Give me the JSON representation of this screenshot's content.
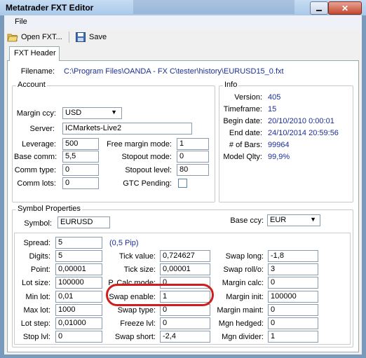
{
  "window": {
    "title": "Metatrader FXT Editor"
  },
  "menu": {
    "file": "File"
  },
  "toolbar": {
    "open": "Open FXT...",
    "save": "Save"
  },
  "tabs": {
    "fxt_header": "FXT Header"
  },
  "filename": {
    "label": "Filename:",
    "value": "C:\\Program Files\\OANDA - FX C\\tester\\history\\EURUSD15_0.fxt"
  },
  "account": {
    "title": "Account",
    "margin_ccy": {
      "label": "Margin ccy:",
      "value": "USD"
    },
    "server": {
      "label": "Server:",
      "value": "ICMarkets-Live2"
    },
    "leverage": {
      "label": "Leverage:",
      "value": "500"
    },
    "base_comm": {
      "label": "Base comm:",
      "value": "5,5"
    },
    "comm_type": {
      "label": "Comm type:",
      "value": "0"
    },
    "comm_lots": {
      "label": "Comm lots:",
      "value": "0"
    },
    "free_margin_mode": {
      "label": "Free margin mode:",
      "value": "1"
    },
    "stopout_mode": {
      "label": "Stopout mode:",
      "value": "0"
    },
    "stopout_level": {
      "label": "Stopout level:",
      "value": "80"
    },
    "gtc_pending": {
      "label": "GTC Pending:",
      "checked": false
    }
  },
  "info": {
    "title": "Info",
    "version": {
      "label": "Version:",
      "value": "405"
    },
    "timeframe": {
      "label": "Timeframe:",
      "value": "15"
    },
    "begin_date": {
      "label": "Begin date:",
      "value": "20/10/2010 0:00:01"
    },
    "end_date": {
      "label": "End date:",
      "value": "24/10/2014 20:59:56"
    },
    "bars": {
      "label": "# of Bars:",
      "value": "99964"
    },
    "model_qlty": {
      "label": "Model Qlty:",
      "value": "99,9%"
    }
  },
  "symbol": {
    "title": "Symbol Properties",
    "symbol": {
      "label": "Symbol:",
      "value": "EURUSD"
    },
    "base_ccy": {
      "label": "Base ccy:",
      "value": "EUR"
    },
    "spread": {
      "label": "Spread:",
      "value": "5",
      "note": "(0,5 Pip)"
    },
    "digits": {
      "label": "Digits:",
      "value": "5"
    },
    "point": {
      "label": "Point:",
      "value": "0,00001"
    },
    "lot_size": {
      "label": "Lot size:",
      "value": "100000"
    },
    "min_lot": {
      "label": "Min lot:",
      "value": "0,01"
    },
    "max_lot": {
      "label": "Max lot:",
      "value": "1000"
    },
    "lot_step": {
      "label": "Lot step:",
      "value": "0,01000"
    },
    "stop_lvl": {
      "label": "Stop lvl:",
      "value": "0"
    },
    "tick_value": {
      "label": "Tick value:",
      "value": "0,724627"
    },
    "tick_size": {
      "label": "Tick size:",
      "value": "0,00001"
    },
    "p_calc_mode": {
      "label": "P. Calc mode:",
      "value": "0"
    },
    "swap_enable": {
      "label": "Swap enable:",
      "value": "1"
    },
    "swap_type": {
      "label": "Swap type:",
      "value": "0"
    },
    "freeze_lvl": {
      "label": "Freeze lvl:",
      "value": "0"
    },
    "swap_short": {
      "label": "Swap short:",
      "value": "-2,4"
    },
    "swap_long": {
      "label": "Swap long:",
      "value": "-1,8"
    },
    "swap_rollo": {
      "label": "Swap roll/o:",
      "value": "3"
    },
    "margin_calc": {
      "label": "Margin calc:",
      "value": "0"
    },
    "margin_init": {
      "label": "Margin init:",
      "value": "100000"
    },
    "margin_maint": {
      "label": "Margin maint:",
      "value": "0"
    },
    "mgn_hedged": {
      "label": "Mgn hedged:",
      "value": "0"
    },
    "mgn_divider": {
      "label": "Mgn divider:",
      "value": "1"
    }
  },
  "colors": {
    "accent_blue": "#1a2e9a",
    "highlight_circle": "#d11d1d"
  },
  "icons": {
    "open": "folder-open-icon",
    "save": "floppy-disk-icon"
  }
}
